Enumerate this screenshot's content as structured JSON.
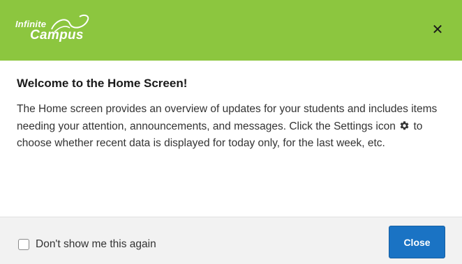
{
  "header": {
    "logo_word1": "Infinite",
    "logo_word2": "Campus",
    "close_glyph": "✕",
    "background_color": "#8cc63f"
  },
  "content": {
    "title": "Welcome to the Home Screen!",
    "text_before_icon": "The Home screen provides an overview of updates for your students and includes items needing your attention, announcements, and messages. Click the Settings icon",
    "icon": "gear-icon",
    "text_after_icon": "to choose whether recent data is displayed for today only, for the last week, etc."
  },
  "footer": {
    "checkbox_label": "Don't show me this again",
    "checkbox_checked": false,
    "close_button_label": "Close",
    "button_color": "#1a73c4"
  }
}
